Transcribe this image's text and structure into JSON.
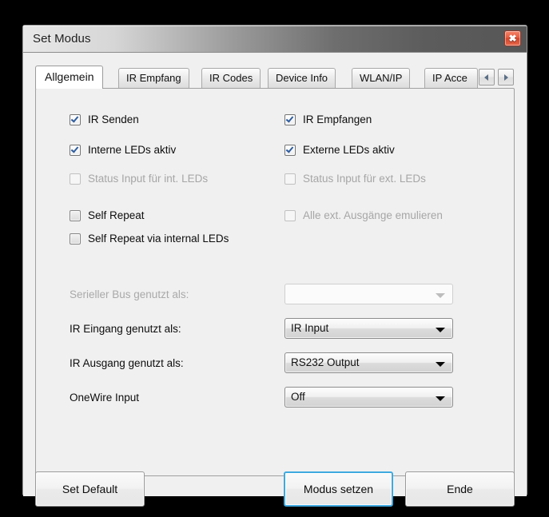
{
  "window": {
    "title": "Set Modus",
    "close_icon": "close-icon",
    "close_glyph": "✖"
  },
  "tabs": {
    "items": [
      {
        "label": "Allgemein",
        "selected": true
      },
      {
        "label": "IR Empfang",
        "selected": false
      },
      {
        "label": "IR Codes",
        "selected": false
      },
      {
        "label": "Device Info",
        "selected": false
      },
      {
        "label": "WLAN/IP",
        "selected": false
      },
      {
        "label": "IP Acce",
        "selected": false
      }
    ],
    "scroll_left_icon": "chevron-left-icon",
    "scroll_right_icon": "chevron-right-icon"
  },
  "checkboxes": {
    "left": [
      {
        "label": "IR Senden",
        "checked": true,
        "disabled": false,
        "style": "plain"
      },
      {
        "label": "Interne LEDs aktiv",
        "checked": true,
        "disabled": false,
        "style": "plain"
      },
      {
        "label": "Status Input für int. LEDs",
        "checked": false,
        "disabled": true,
        "style": "plain"
      },
      {
        "label": "Self Repeat",
        "checked": false,
        "disabled": false,
        "style": "gradient"
      },
      {
        "label": "Self Repeat via internal LEDs",
        "checked": false,
        "disabled": false,
        "style": "gradient"
      }
    ],
    "right": [
      {
        "label": "IR Empfangen",
        "checked": true,
        "disabled": false,
        "style": "plain"
      },
      {
        "label": "Externe LEDs aktiv",
        "checked": true,
        "disabled": false,
        "style": "plain"
      },
      {
        "label": "Status Input für ext. LEDs",
        "checked": false,
        "disabled": true,
        "style": "plain"
      },
      {
        "label": "Alle ext. Ausgänge emulieren",
        "checked": false,
        "disabled": true,
        "style": "plain"
      }
    ]
  },
  "combos": [
    {
      "label": "Serieller Bus genutzt als:",
      "value": "",
      "disabled": true
    },
    {
      "label": "IR Eingang genutzt als:",
      "value": "IR Input",
      "disabled": false
    },
    {
      "label": "IR Ausgang genutzt als:",
      "value": "RS232 Output",
      "disabled": false
    },
    {
      "label": "OneWire Input",
      "value": "Off",
      "disabled": false
    }
  ],
  "buttons": {
    "set_default": "Set Default",
    "modus_setzen": "Modus setzen",
    "ende": "Ende"
  },
  "colors": {
    "accent": "#3fa9e0",
    "close_red": "#e85c3f",
    "check_blue": "#2d5c9e",
    "window_bg": "#f0f0f0",
    "desktop": "#000000"
  }
}
